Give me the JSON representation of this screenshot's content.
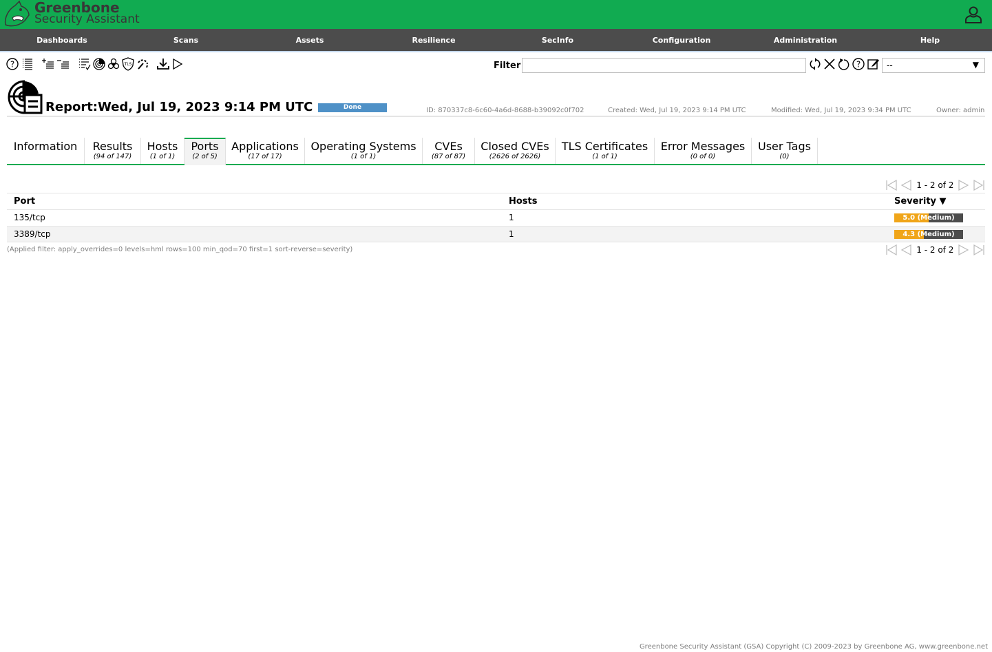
{
  "brand": {
    "line1": "Greenbone",
    "line2": "Security Assistant"
  },
  "colors": {
    "brand_green": "#11ab51",
    "menu_bg": "#4c4c4c",
    "status_done": "#4f91c7",
    "severity_medium": "#f0a519",
    "severity_track": "#4c4c4c"
  },
  "menu": [
    {
      "label": "Dashboards"
    },
    {
      "label": "Scans"
    },
    {
      "label": "Assets"
    },
    {
      "label": "Resilience"
    },
    {
      "label": "SecInfo"
    },
    {
      "label": "Configuration"
    },
    {
      "label": "Administration"
    },
    {
      "label": "Help"
    }
  ],
  "toolbar": {
    "icons": [
      "help-icon",
      "list-icon",
      "add-to-assets-icon",
      "remove-from-assets-icon",
      "results-list-icon",
      "scan-icon",
      "biohazard-icon",
      "tls-icon",
      "performance-icon",
      "download-icon",
      "start-icon"
    ],
    "filter_label": "Filter",
    "filter_value": "",
    "filter_action_icons": [
      "refresh-icon",
      "clear-icon",
      "reset-icon",
      "help-icon",
      "edit-icon"
    ],
    "filter_select_value": "--"
  },
  "report": {
    "title": "Report:Wed, Jul 19, 2023 9:14 PM UTC",
    "status": "Done",
    "id": "ID: 870337c8-6c60-4a6d-8688-b39092c0f702",
    "created": "Created: Wed, Jul 19, 2023 9:14 PM UTC",
    "modified": "Modified: Wed, Jul 19, 2023 9:34 PM UTC",
    "owner": "Owner: admin"
  },
  "tabs": [
    {
      "label": "Information",
      "count": ""
    },
    {
      "label": "Results",
      "count": "(94 of 147)"
    },
    {
      "label": "Hosts",
      "count": "(1 of 1)"
    },
    {
      "label": "Ports",
      "count": "(2 of 5)",
      "active": true
    },
    {
      "label": "Applications",
      "count": "(17 of 17)"
    },
    {
      "label": "Operating Systems",
      "count": "(1 of 1)"
    },
    {
      "label": "CVEs",
      "count": "(87 of 87)"
    },
    {
      "label": "Closed CVEs",
      "count": "(2626 of 2626)"
    },
    {
      "label": "TLS Certificates",
      "count": "(1 of 1)"
    },
    {
      "label": "Error Messages",
      "count": "(0 of 0)"
    },
    {
      "label": "User Tags",
      "count": "(0)"
    }
  ],
  "pagination": {
    "text": "1 - 2 of 2"
  },
  "table": {
    "headers": {
      "port": "Port",
      "hosts": "Hosts",
      "severity": "Severity ▼"
    },
    "rows": [
      {
        "port": "135/tcp",
        "hosts": "1",
        "severity_score": 5.0,
        "severity_label": "5.0 (Medium)"
      },
      {
        "port": "3389/tcp",
        "hosts": "1",
        "severity_score": 4.3,
        "severity_label": "4.3 (Medium)"
      }
    ]
  },
  "applied_filter": "(Applied filter: apply_overrides=0 levels=hml rows=100 min_qod=70 first=1 sort-reverse=severity)",
  "footer": "Greenbone Security Assistant (GSA) Copyright (C) 2009-2023 by Greenbone AG, www.greenbone.net"
}
